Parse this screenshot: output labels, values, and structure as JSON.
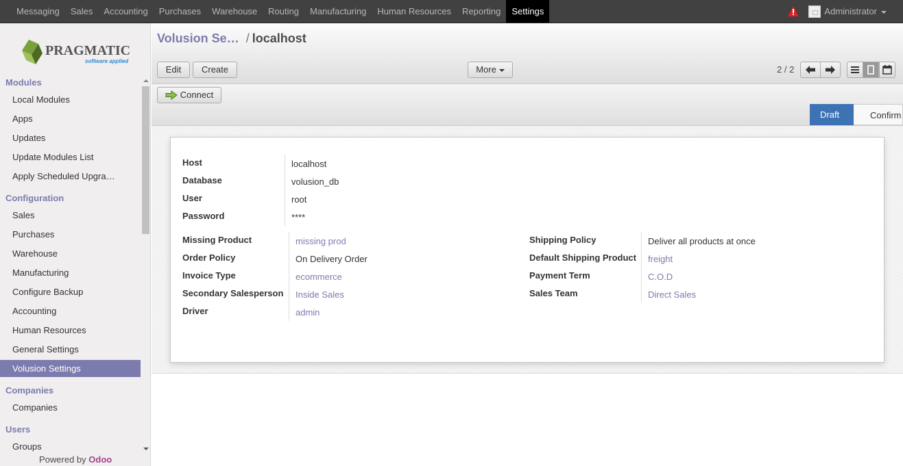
{
  "topbar": {
    "menu": [
      "Messaging",
      "Sales",
      "Accounting",
      "Purchases",
      "Warehouse",
      "Routing",
      "Manufacturing",
      "Human Resources",
      "Reporting",
      "Settings"
    ],
    "active": "Settings",
    "user": "Administrator",
    "warning_icon": "warning-triangle-icon"
  },
  "logo": {
    "name": "PRAGMATIC",
    "tagline": "software applied"
  },
  "sidebar": {
    "sections": [
      {
        "title": "Modules",
        "items": [
          "Local Modules",
          "Apps",
          "Updates",
          "Update Modules List",
          "Apply Scheduled Upgra…"
        ]
      },
      {
        "title": "Configuration",
        "items": [
          "Sales",
          "Purchases",
          "Warehouse",
          "Manufacturing",
          "Configure Backup",
          "Accounting",
          "Human Resources",
          "General Settings",
          "Volusion Settings"
        ]
      },
      {
        "title": "Companies",
        "items": [
          "Companies"
        ]
      },
      {
        "title": "Users",
        "items": [
          "Groups"
        ]
      }
    ],
    "active_item": "Volusion Settings",
    "powered_by": "Powered by",
    "powered_brand": "Odoo"
  },
  "breadcrumb": {
    "parent": "Volusion Se…",
    "separator": "/",
    "current": "localhost"
  },
  "toolbar": {
    "edit": "Edit",
    "create": "Create",
    "more": "More",
    "pager": "2 / 2"
  },
  "connect_label": "Connect",
  "stages": {
    "draft": "Draft",
    "confirm": "Confirm",
    "active": "Draft"
  },
  "form": {
    "top": [
      {
        "label": "Host",
        "value": "localhost"
      },
      {
        "label": "Database",
        "value": "volusion_db"
      },
      {
        "label": "User",
        "value": "root"
      },
      {
        "label": "Password",
        "value": "****"
      }
    ],
    "left": [
      {
        "label": "Missing Product",
        "value": "missing prod",
        "link": true
      },
      {
        "label": "Order Policy",
        "value": "On Delivery Order",
        "link": false
      },
      {
        "label": "Invoice Type",
        "value": "ecommerce",
        "link": true
      },
      {
        "label": "Secondary Salesperson",
        "value": "Inside Sales",
        "link": true
      },
      {
        "label": "Driver",
        "value": "admin",
        "link": true
      }
    ],
    "right": [
      {
        "label": "Shipping Policy",
        "value": "Deliver all products at once",
        "link": false
      },
      {
        "label": "Default Shipping Product",
        "value": "freight",
        "link": true
      },
      {
        "label": "Payment Term",
        "value": "C.O.D",
        "link": true
      },
      {
        "label": "Sales Team",
        "value": "Direct Sales",
        "link": true
      }
    ]
  },
  "colors": {
    "accent": "#7c7bad",
    "stage_active": "#3d73b3",
    "topbar": "#414141",
    "warning": "#e02020",
    "odoo": "#a24689"
  }
}
